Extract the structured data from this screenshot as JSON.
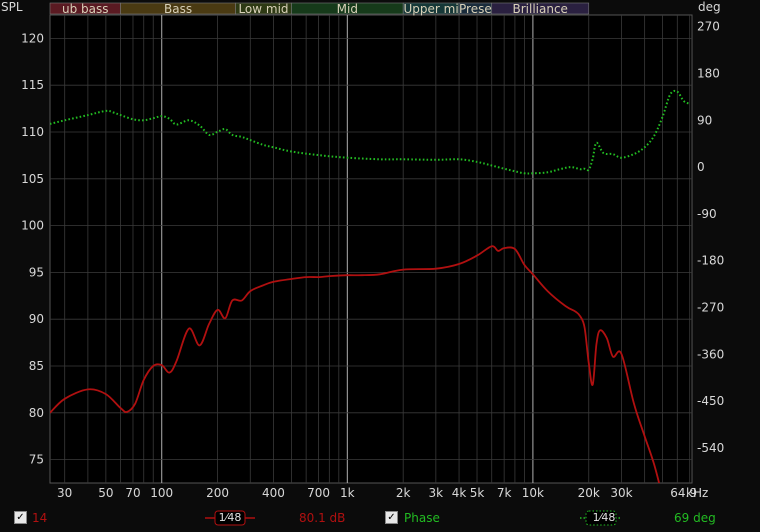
{
  "chart_data": {
    "type": "line",
    "x_scale": "log",
    "xlim": [
      25,
      72000
    ],
    "xlabel": "kHz",
    "x_tick_labels": [
      {
        "f": 30,
        "label": "30"
      },
      {
        "f": 50,
        "label": "50"
      },
      {
        "f": 70,
        "label": "70"
      },
      {
        "f": 100,
        "label": "100"
      },
      {
        "f": 200,
        "label": "200"
      },
      {
        "f": 400,
        "label": "400"
      },
      {
        "f": 700,
        "label": "700"
      },
      {
        "f": 1000,
        "label": "1k"
      },
      {
        "f": 2000,
        "label": "2k"
      },
      {
        "f": 3000,
        "label": "3k"
      },
      {
        "f": 4000,
        "label": "4k"
      },
      {
        "f": 5000,
        "label": "5k"
      },
      {
        "f": 7000,
        "label": "7k"
      },
      {
        "f": 10000,
        "label": "10k"
      },
      {
        "f": 20000,
        "label": "20k"
      },
      {
        "f": 30000,
        "label": "30k"
      },
      {
        "f": 64900,
        "label": "64.9"
      }
    ],
    "x_unit_label": "kHz",
    "left_axis": {
      "label": "SPL",
      "ylim": [
        72.5,
        122.5
      ],
      "ticks": [
        75,
        80,
        85,
        90,
        95,
        100,
        105,
        110,
        115,
        120
      ]
    },
    "right_axis": {
      "label": "deg",
      "ylim": [
        -607.5,
        292.5
      ],
      "ticks": [
        270,
        180,
        90,
        0,
        -90,
        -180,
        -270,
        -360,
        -450,
        -540
      ]
    },
    "grid": true,
    "bands": [
      {
        "name": "ub bass",
        "from": 25,
        "to": 60,
        "color": "#5a1a22"
      },
      {
        "name": "Bass",
        "from": 60,
        "to": 250,
        "color": "#4a3a12"
      },
      {
        "name": "Low mid",
        "from": 250,
        "to": 500,
        "color": "#2e3a14"
      },
      {
        "name": "Mid",
        "from": 500,
        "to": 2000,
        "color": "#163a1a"
      },
      {
        "name": "Upper mi",
        "from": 2000,
        "to": 4000,
        "color": "#163838"
      },
      {
        "name": "Prese",
        "from": 4000,
        "to": 6000,
        "color": "#1a2c3c"
      },
      {
        "name": "Brilliance",
        "from": 6000,
        "to": 20000,
        "color": "#2a2040"
      }
    ],
    "series": [
      {
        "axis": "left",
        "color": "#b01010",
        "style": "solid",
        "x": [
          25,
          30,
          40,
          50,
          60,
          65,
          72,
          80,
          90,
          100,
          110,
          120,
          140,
          160,
          180,
          200,
          220,
          240,
          270,
          300,
          350,
          400,
          500,
          600,
          700,
          800,
          1000,
          1200,
          1500,
          2000,
          3000,
          4000,
          5000,
          6000,
          6500,
          7000,
          8000,
          9000,
          10000,
          12000,
          15000,
          17000,
          18000,
          19000,
          20000,
          21000,
          22000,
          23000,
          25000,
          27000,
          30000,
          35000,
          40000,
          45000,
          50000
        ],
        "y": [
          80.0,
          81.5,
          82.5,
          82.0,
          80.5,
          80.1,
          81.0,
          83.5,
          85.0,
          85.1,
          84.3,
          85.5,
          89.0,
          87.2,
          89.5,
          91.0,
          90.1,
          92.0,
          92.0,
          93.0,
          93.6,
          94.0,
          94.3,
          94.5,
          94.5,
          94.6,
          94.7,
          94.7,
          94.8,
          95.3,
          95.4,
          95.9,
          96.8,
          97.8,
          97.3,
          97.6,
          97.5,
          95.8,
          94.8,
          93.0,
          91.4,
          90.8,
          90.3,
          89.1,
          85.3,
          83.0,
          87.3,
          88.8,
          88.0,
          86.0,
          86.3,
          81.0,
          77.5,
          74.5,
          71.0
        ]
      },
      {
        "axis": "right",
        "color": "#22bb22",
        "style": "dotted",
        "x": [
          25,
          30,
          40,
          50,
          55,
          60,
          70,
          80,
          90,
          100,
          110,
          120,
          140,
          160,
          180,
          200,
          220,
          240,
          270,
          300,
          350,
          400,
          500,
          700,
          1000,
          1500,
          2000,
          3000,
          4000,
          5000,
          6000,
          7000,
          8000,
          9000,
          10000,
          12000,
          14000,
          16000,
          18000,
          19000,
          20000,
          21000,
          22000,
          24000,
          27000,
          30000,
          35000,
          40000,
          45000,
          50000,
          55000,
          60000,
          65000,
          70000
        ],
        "y": [
          83,
          90,
          100,
          108,
          105,
          100,
          92,
          90,
          94,
          98,
          93,
          82,
          90,
          80,
          62,
          68,
          73,
          62,
          58,
          52,
          43,
          38,
          30,
          23,
          18,
          15,
          15,
          14,
          15,
          10,
          3,
          -3,
          -8,
          -12,
          -12,
          -10,
          -4,
          0,
          -4,
          -3,
          -5,
          16,
          47,
          27,
          25,
          18,
          25,
          38,
          60,
          97,
          140,
          145,
          127,
          122
        ]
      }
    ],
    "legend": {
      "spl": {
        "checked": "✓",
        "value": "14",
        "smoothing": "1⁄48",
        "level": "80.1 dB"
      },
      "phase": {
        "checked": "✓",
        "label": "Phase",
        "smoothing": "1⁄48",
        "value": "69 deg"
      }
    }
  }
}
